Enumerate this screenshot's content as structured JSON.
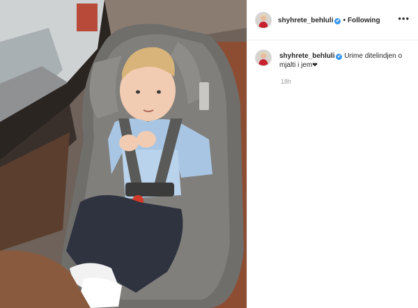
{
  "post": {
    "author": {
      "username": "shyhrete_behluli",
      "verified_mark": "✔",
      "avatar_icon": "profile-photo-icon"
    },
    "header": {
      "separator": "•",
      "follow_status": "Following",
      "more_options": "•••"
    },
    "caption": {
      "username": "shyhrete_behluli",
      "text": "Urime ditelindjen o mjalti i jem",
      "heart": "❤"
    },
    "time_ago": "18h"
  },
  "colors": {
    "verified_badge": "#3897f0",
    "text": "#262626",
    "muted": "#999999"
  }
}
